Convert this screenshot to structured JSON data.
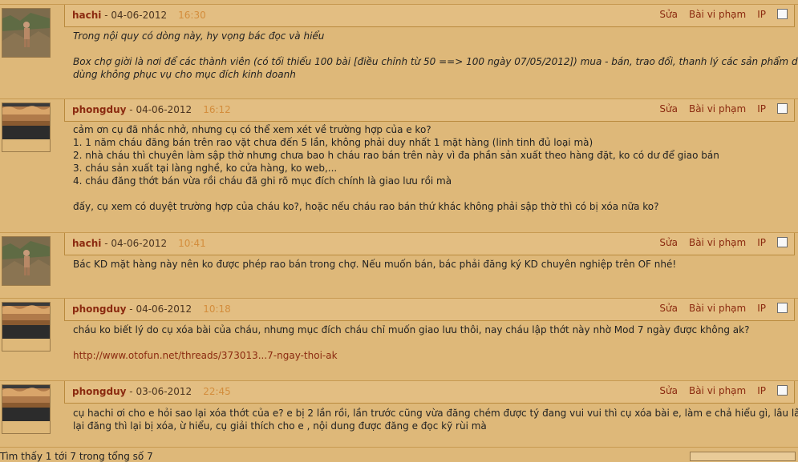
{
  "posts": [
    {
      "user": "hachi",
      "date": "04-06-2012",
      "time": "16:30",
      "italic": true,
      "lines": [
        "Trong nội quy có dòng này, hy vọng bác đọc và hiểu",
        "",
        "Box chợ giời là nơi để các thành viên (có tối thiểu 100 bài [điều chỉnh từ 50 ==> 100 ngày 07/05/2012]) mua - bán, trao đổi, thanh lý các sản phẩm dư",
        "dùng không phục vụ cho mục đích kinh doanh"
      ]
    },
    {
      "user": "phongduy",
      "date": "04-06-2012",
      "time": "16:12",
      "italic": false,
      "lines": [
        "cảm ơn cụ đã nhắc nhở, nhưng cụ có thể xem xét về trường hợp của e ko?",
        "1. 1 năm cháu đăng bán trên rao vặt chưa đến 5 lần, không phải duy nhất 1 mặt hàng (linh tinh đủ loại mà)",
        "2. nhà cháu thì chuyên làm sập thờ nhưng chưa bao h cháu rao bán trên này vì đa phần sản xuất theo hàng đặt, ko có dư để giao bán",
        "3. cháu sản xuất tại làng nghề, ko cửa hàng, ko web,...",
        "4. cháu đăng thớt bán vừa rồi cháu đã ghi rõ mục đích chính là giao lưu rồi mà",
        "",
        "đấy, cụ xem có duyệt trường hợp của cháu ko?, hoặc nếu cháu rao bán thứ khác không phải sập thờ thì có bị xóa nữa ko?"
      ]
    },
    {
      "user": "hachi",
      "date": "04-06-2012",
      "time": "10:41",
      "italic": false,
      "lines": [
        "Bác KD mặt hàng này nên ko được phép rao bán trong chợ. Nếu muốn bán, bác phải đăng ký KD chuyên nghiệp trên OF nhé!"
      ]
    },
    {
      "user": "phongduy",
      "date": "04-06-2012",
      "time": "10:18",
      "italic": false,
      "lines": [
        "cháu ko biết lý do cụ xóa bài của cháu, nhưng mục đích cháu chỉ muốn giao lưu thôi, nay cháu lập thớt này nhờ Mod 7 ngày được không ak?",
        ""
      ],
      "link": "http://www.otofun.net/threads/373013...7-ngay-thoi-ak"
    },
    {
      "user": "phongduy",
      "date": "03-06-2012",
      "time": "22:45",
      "italic": false,
      "lines": [
        "cụ hachi ơi cho e hỏi sao lại xóa thớt của e? e bị 2 lần rồi, lần trước cũng vừa đăng chém được tý đang vui vui thì cụ xóa bài e, làm e chả hiểu gì, lâu lâu mới",
        "lại đăng thì lại bị xóa, ừ hiểu, cụ giải thích cho e , nội dung được đăng e đọc kỹ rùi mà"
      ]
    }
  ],
  "labels": {
    "sep": " - ",
    "edit": "Sửa",
    "report": "Bài vi phạm",
    "ip": "IP"
  },
  "footer": {
    "partial_text": "Tìm thấy 1 tới 7 trong tổng số 7"
  },
  "colors": {
    "background": "#deb879",
    "header": "#e3be82",
    "username": "#8b2a10",
    "time": "#d38d3c",
    "link": "#8b2a10"
  }
}
